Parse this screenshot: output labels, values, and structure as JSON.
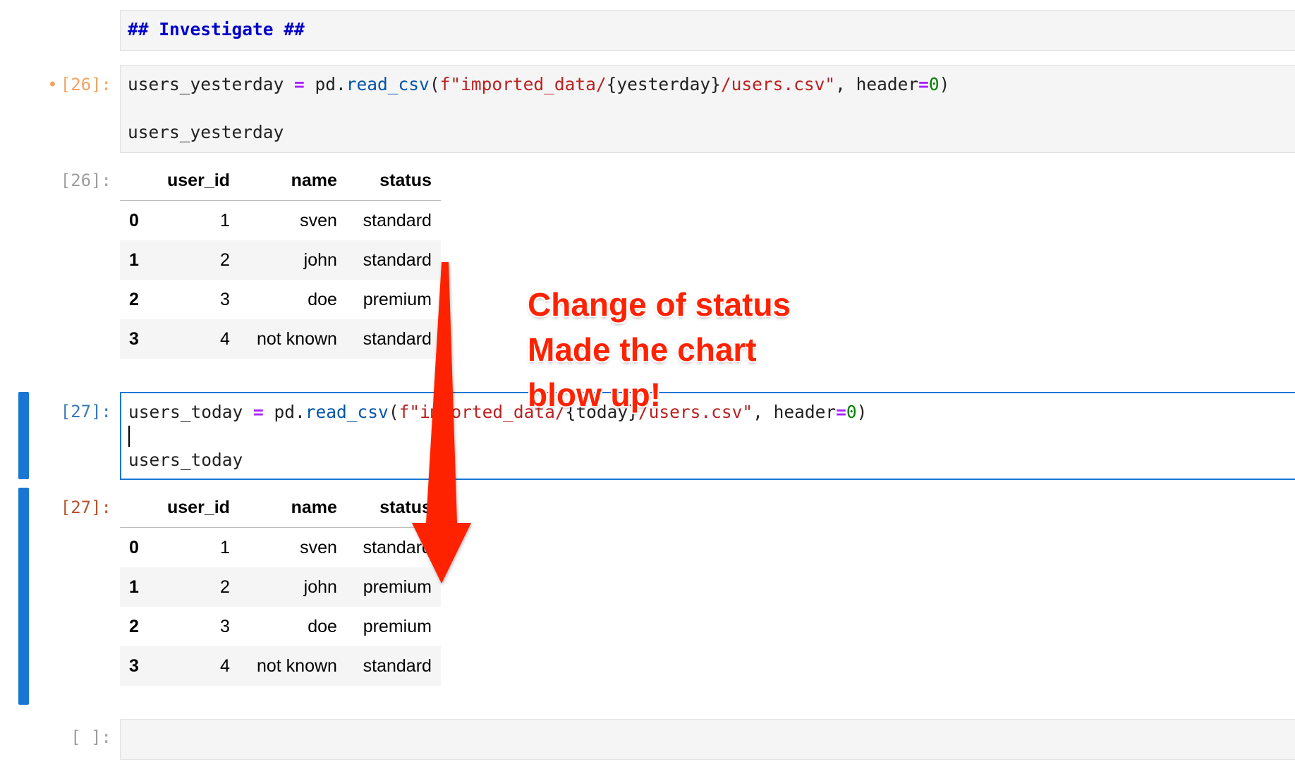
{
  "cells": {
    "markdown": {
      "text": "## Investigate ##"
    },
    "cell26": {
      "in_prompt": "[26]:",
      "unsaved_dot": "•",
      "code_line1": {
        "var": "users_yesterday",
        "eq": " = ",
        "obj": "pd.",
        "fn": "read_csv",
        "open": "(",
        "str1": "f\"imported_data/",
        "interp": "{yesterday}",
        "str2": "/users.csv\"",
        "sep": ", header",
        "eq2": "=",
        "num": "0",
        "close": ")"
      },
      "code_line2": "users_yesterday",
      "out_prompt": "[26]:",
      "table": {
        "columns": [
          "user_id",
          "name",
          "status"
        ],
        "rows": [
          {
            "index": "0",
            "user_id": "1",
            "name": "sven",
            "status": "standard"
          },
          {
            "index": "1",
            "user_id": "2",
            "name": "john",
            "status": "standard"
          },
          {
            "index": "2",
            "user_id": "3",
            "name": "doe",
            "status": "premium"
          },
          {
            "index": "3",
            "user_id": "4",
            "name": "not known",
            "status": "standard"
          }
        ]
      }
    },
    "cell27": {
      "in_prompt": "[27]:",
      "code_line1": {
        "var": "users_today",
        "eq": " = ",
        "obj": "pd.",
        "fn": "read_csv",
        "open": "(",
        "str1": "f\"imported_data/",
        "interp": "{today}",
        "str2": "/users.csv\"",
        "sep": ", header",
        "eq2": "=",
        "num": "0",
        "close": ")"
      },
      "code_line2": "users_today",
      "out_prompt": "[27]:",
      "table": {
        "columns": [
          "user_id",
          "name",
          "status"
        ],
        "rows": [
          {
            "index": "0",
            "user_id": "1",
            "name": "sven",
            "status": "standard"
          },
          {
            "index": "1",
            "user_id": "2",
            "name": "john",
            "status": "premium"
          },
          {
            "index": "2",
            "user_id": "3",
            "name": "doe",
            "status": "premium"
          },
          {
            "index": "3",
            "user_id": "4",
            "name": "not known",
            "status": "standard"
          }
        ]
      }
    },
    "empty_cell": {
      "in_prompt": "[ ]:"
    }
  },
  "annotation": {
    "lines": [
      "Change of status",
      "Made the chart",
      "blow up!"
    ],
    "color": "#ff2200"
  },
  "colors": {
    "accent": "#1976d2",
    "keyword_op": "#aa22ff",
    "function": "#0055aa",
    "string": "#ba2121",
    "number": "#008000",
    "markdown_heading": "#0000cc"
  }
}
